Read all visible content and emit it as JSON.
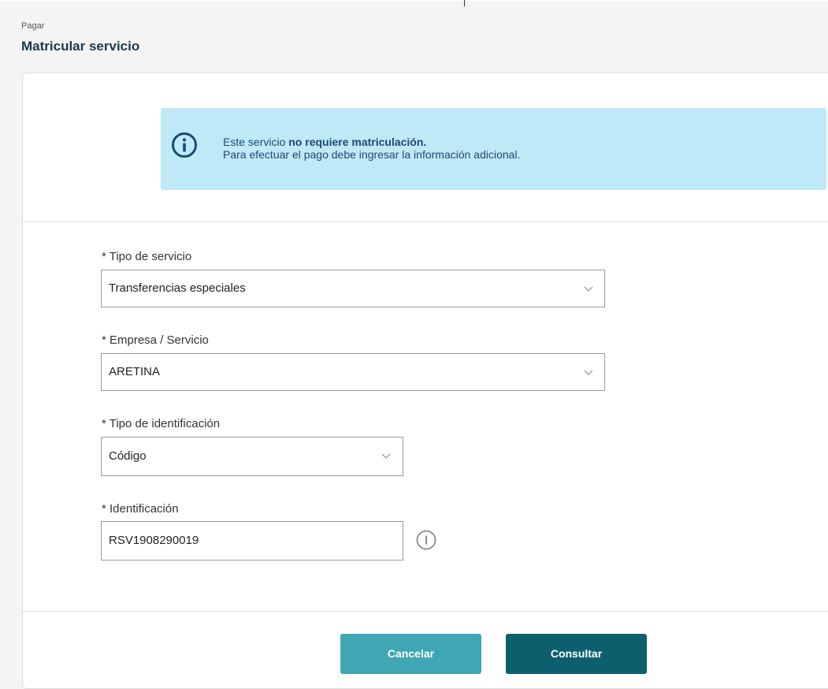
{
  "breadcrumb": "Pagar",
  "title": "Matricular servicio",
  "alert": {
    "line1_prefix": "Este servicio ",
    "line1_bold": "no requiere matriculación.",
    "line2": "Para efectuar el pago debe ingresar la información adicional.",
    "icon": "info-icon"
  },
  "form": {
    "tipo_servicio": {
      "label": "* Tipo de servicio",
      "value": "Transferencias especiales"
    },
    "empresa": {
      "label": "* Empresa / Servicio",
      "value": "ARETINA"
    },
    "tipo_id": {
      "label": "* Tipo de identificación",
      "value": "Código"
    },
    "identificacion": {
      "label": "* Identificación",
      "value": "RSV1908290019"
    }
  },
  "buttons": {
    "cancel": "Cancelar",
    "submit": "Consultar"
  },
  "colors": {
    "alert_bg": "#bfe9f7",
    "alert_text": "#1b4a74",
    "cancel_btn": "#3fa7b3",
    "submit_btn": "#0d5f6e",
    "title": "#1b3a4b"
  }
}
